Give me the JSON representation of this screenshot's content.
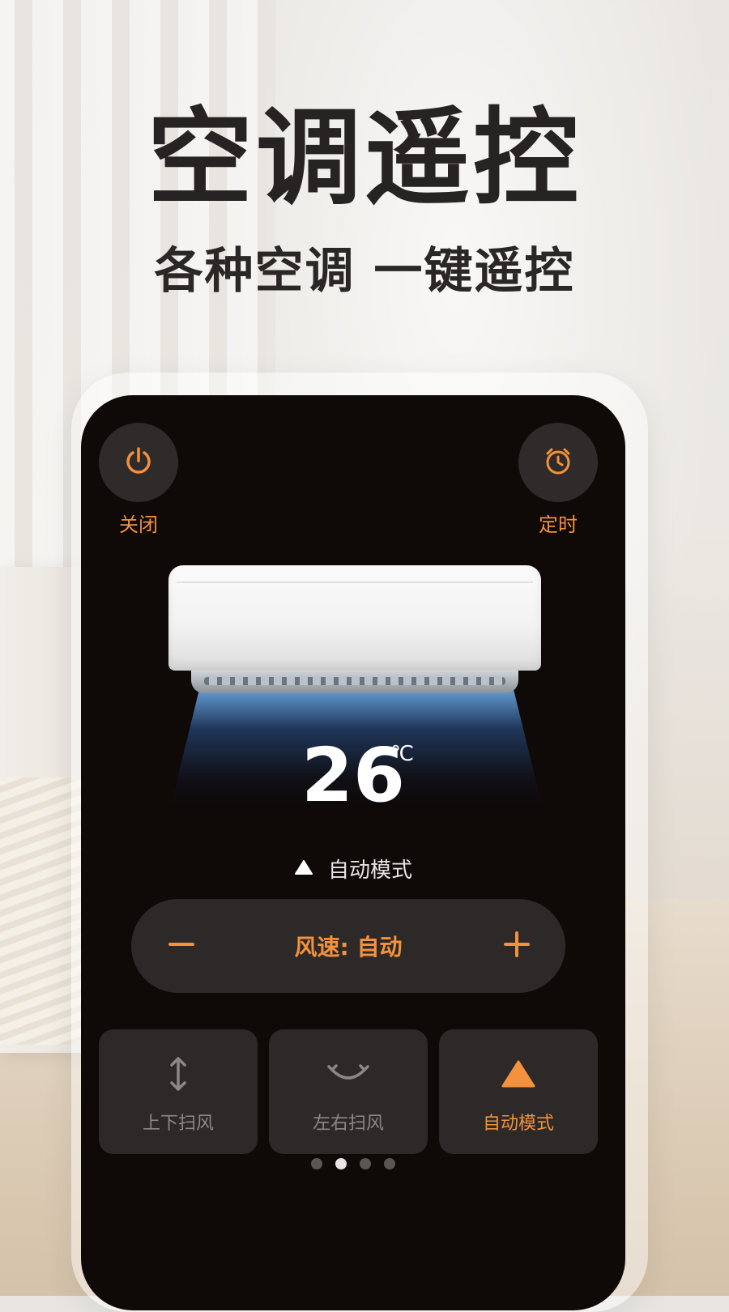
{
  "headline": "空调遥控",
  "subhead": "各种空调 一键遥控",
  "remote": {
    "power": {
      "label": "关闭",
      "icon": "power-icon"
    },
    "timer": {
      "label": "定时",
      "icon": "alarm-clock-icon"
    },
    "temperature": {
      "value": "26",
      "unit": "℃"
    },
    "mode": {
      "icon": "triangle-icon",
      "label": "自动模式"
    },
    "fan_speed": {
      "label": "风速: 自动",
      "minus_icon": "minus-icon",
      "plus_icon": "plus-icon"
    },
    "tiles": [
      {
        "label": "上下扫风",
        "icon": "vertical-swing-icon",
        "active": false
      },
      {
        "label": "左右扫风",
        "icon": "horizontal-swing-icon",
        "active": false
      },
      {
        "label": "自动模式",
        "icon": "triangle-icon",
        "active": true
      }
    ],
    "page_indicator": {
      "count": 4,
      "active_index": 1
    }
  },
  "colors": {
    "accent": "#f3913c",
    "phone_bg": "#0f0908",
    "control_bg": "#2c2928",
    "headline": "#262322"
  }
}
